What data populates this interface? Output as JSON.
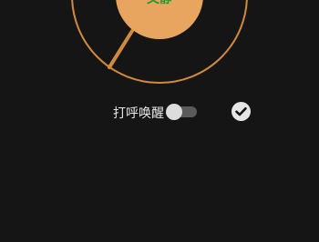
{
  "dial": {
    "center_text": "文静",
    "ring_color": "#d18a3c",
    "knob_color": "#e8a560",
    "text_color": "#1f9a2a"
  },
  "controls": {
    "wake_label": "打呼唤醒",
    "wake_toggle_on": false
  },
  "icons": {
    "confirm": "check-icon"
  }
}
